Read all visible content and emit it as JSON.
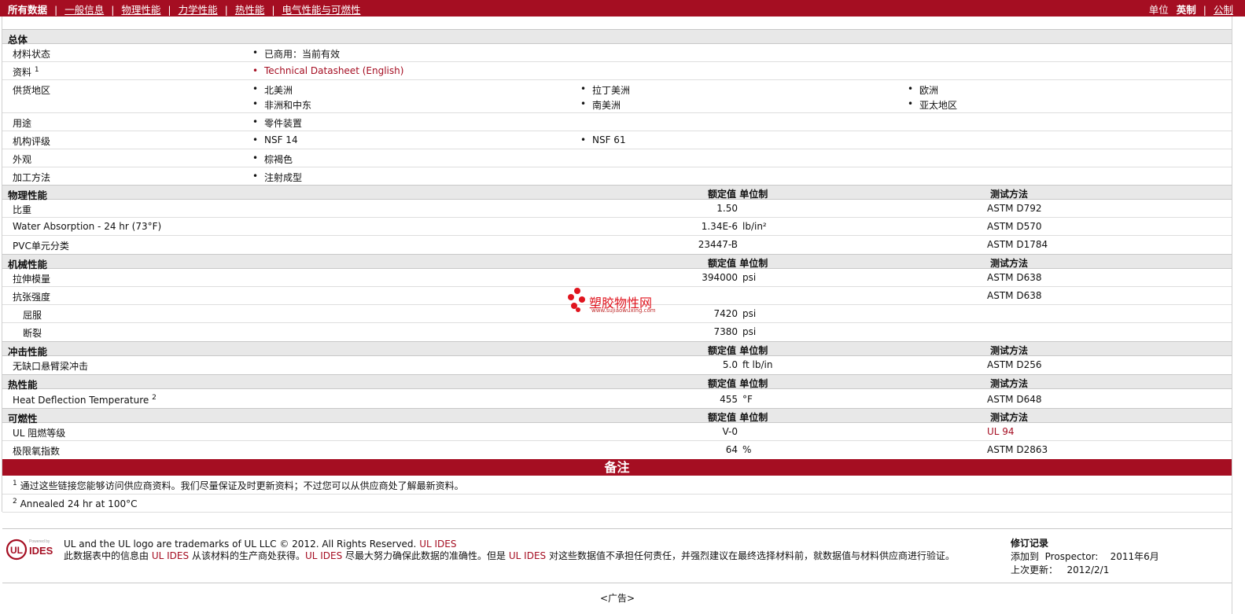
{
  "nav": {
    "all_data": "所有数据",
    "links": [
      "一般信息",
      "物理性能",
      "力学性能",
      "热性能",
      "电气性能与可燃性"
    ],
    "units_label": "单位",
    "unit_english": "英制",
    "unit_metric": "公制"
  },
  "general": {
    "title": "总体",
    "rows": [
      {
        "label": "材料状态",
        "items": [
          "已商用：当前有效"
        ]
      },
      {
        "label": "资料",
        "sup": "1",
        "items": [
          "Technical Datasheet (English)"
        ]
      },
      {
        "label": "供货地区",
        "items": [
          "北美洲",
          "拉丁美洲",
          "欧洲",
          "非洲和中东",
          "南美洲",
          "亚太地区"
        ]
      },
      {
        "label": "用途",
        "items": [
          "零件装置"
        ]
      },
      {
        "label": "机构评级",
        "items": [
          "NSF 14",
          "NSF 61"
        ]
      },
      {
        "label": "外观",
        "items": [
          "棕褐色"
        ]
      },
      {
        "label": "加工方法",
        "items": [
          "注射成型"
        ]
      }
    ]
  },
  "col_headers": {
    "value": "额定值",
    "unit": "单位制",
    "method": "测试方法"
  },
  "physical": {
    "title": "物理性能",
    "rows": [
      {
        "label": "比重",
        "value": "1.50",
        "unit": "",
        "method": "ASTM D792"
      },
      {
        "label": "Water Absorption - 24 hr (73°F)",
        "value": "1.34E-6",
        "unit": "lb/in²",
        "method": "ASTM D570"
      },
      {
        "label": "PVC单元分类",
        "value": "23447-B",
        "unit": "",
        "method": "ASTM D1784"
      }
    ]
  },
  "mechanical": {
    "title": "机械性能",
    "rows": [
      {
        "label": "拉伸模量",
        "value": "394000",
        "unit": "psi",
        "method": "ASTM D638"
      },
      {
        "label": "抗张强度",
        "value": "",
        "unit": "",
        "method": "ASTM D638"
      },
      {
        "label": "屈服",
        "value": "7420",
        "unit": "psi",
        "method": ""
      },
      {
        "label": "断裂",
        "value": "7380",
        "unit": "psi",
        "method": ""
      }
    ]
  },
  "impact": {
    "title": "冲击性能",
    "rows": [
      {
        "label": "无缺口悬臂梁冲击",
        "value": "5.0",
        "unit": "ft lb/in",
        "method": "ASTM D256"
      }
    ]
  },
  "thermal": {
    "title": "热性能",
    "rows": [
      {
        "label": "Heat Deflection Temperature",
        "sup": "2",
        "value": "455",
        "unit": "°F",
        "method": "ASTM D648"
      }
    ]
  },
  "flammability": {
    "title": "可燃性",
    "rows": [
      {
        "label": "UL 阻燃等级",
        "value": "V-0",
        "unit": "",
        "method": "UL 94"
      },
      {
        "label": "极限氧指数",
        "value": "64",
        "unit": "%",
        "method": "ASTM D2863"
      }
    ]
  },
  "watermark": {
    "name": "塑胶物性网",
    "url": "www.sujiaowuxing.com"
  },
  "notes": {
    "title": "备注",
    "items": [
      {
        "num": "1",
        "text": "通过这些链接您能够访问供应商资料。我们尽量保证及时更新资料；不过您可以从供应商处了解最新资料。"
      },
      {
        "num": "2",
        "text": "Annealed 24 hr at 100°C"
      }
    ]
  },
  "footer": {
    "logo_powered": "Powered by",
    "logo_ul": "UL",
    "logo_ides": "IDES",
    "trademark": "UL and the UL logo are trademarks of UL LLC © 2012. All Rights Reserved.",
    "trademark_link": "UL IDES",
    "disclaimer_1": "此数据表中的信息由",
    "disclaimer_link1": "UL IDES",
    "disclaimer_2": "从该材料的生产商处获得。",
    "disclaimer_link2": "UL IDES",
    "disclaimer_3": "尽最大努力确保此数据的准确性。但是",
    "disclaimer_link3": "UL IDES",
    "disclaimer_4": "对这些数据值不承担任何责任，并强烈建议在最终选择材料前，就数据值与材料供应商进行验证。",
    "revision_title": "修订记录",
    "added_label": "添加到",
    "added_source": "Prospector:",
    "added_date": "2011年6月",
    "updated_label": "上次更新：",
    "updated_date": "2012/2/1"
  },
  "ad": "<广告>",
  "colors": {
    "brand": "#a50e22",
    "section_bg": "#e8e8e8",
    "link": "#a50e22"
  }
}
